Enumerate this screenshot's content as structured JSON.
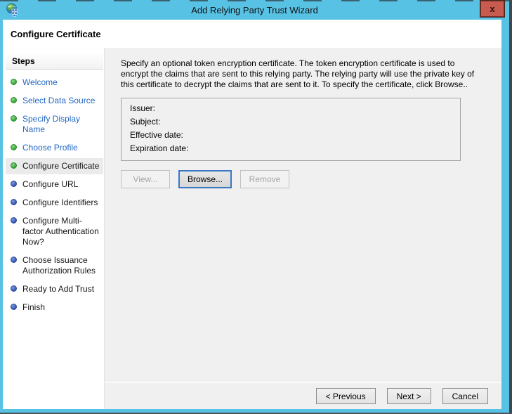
{
  "titlebar": {
    "title": "Add Relying Party Trust Wizard",
    "app_icon": "adfs-globe-icon",
    "close_icon": "x"
  },
  "page": {
    "title": "Configure Certificate"
  },
  "sidebar": {
    "heading": "Steps",
    "items": [
      {
        "label": "Welcome",
        "status": "done"
      },
      {
        "label": "Select Data Source",
        "status": "done"
      },
      {
        "label": "Specify Display Name",
        "status": "done"
      },
      {
        "label": "Choose Profile",
        "status": "done"
      },
      {
        "label": "Configure Certificate",
        "status": "current"
      },
      {
        "label": "Configure URL",
        "status": "pending"
      },
      {
        "label": "Configure Identifiers",
        "status": "pending"
      },
      {
        "label": "Configure Multi-factor Authentication Now?",
        "status": "pending"
      },
      {
        "label": "Choose Issuance Authorization Rules",
        "status": "pending"
      },
      {
        "label": "Ready to Add Trust",
        "status": "pending"
      },
      {
        "label": "Finish",
        "status": "pending"
      }
    ]
  },
  "content": {
    "description": "Specify an optional token encryption certificate.  The token encryption certificate is used to encrypt the claims that are sent to this relying party.  The relying party will use the private key of this certificate to decrypt the claims that are sent to it.  To specify the certificate, click Browse..",
    "certificate": {
      "rows": [
        {
          "label": "Issuer:",
          "value": ""
        },
        {
          "label": "Subject:",
          "value": ""
        },
        {
          "label": "Effective date:",
          "value": ""
        },
        {
          "label": "Expiration date:",
          "value": ""
        }
      ]
    },
    "buttons": {
      "view": "View...",
      "browse": "Browse...",
      "remove": "Remove"
    }
  },
  "footer": {
    "previous": "< Previous",
    "next": "Next >",
    "cancel": "Cancel"
  },
  "colors": {
    "frame_blue": "#58c2e5",
    "close_red": "#c75b50",
    "content_gray": "#f0f0f0",
    "link_blue": "#2368c4",
    "done_dot_green": "#35a435",
    "pending_dot_blue": "#3356b4",
    "focus_border_blue": "#3b78c3"
  }
}
